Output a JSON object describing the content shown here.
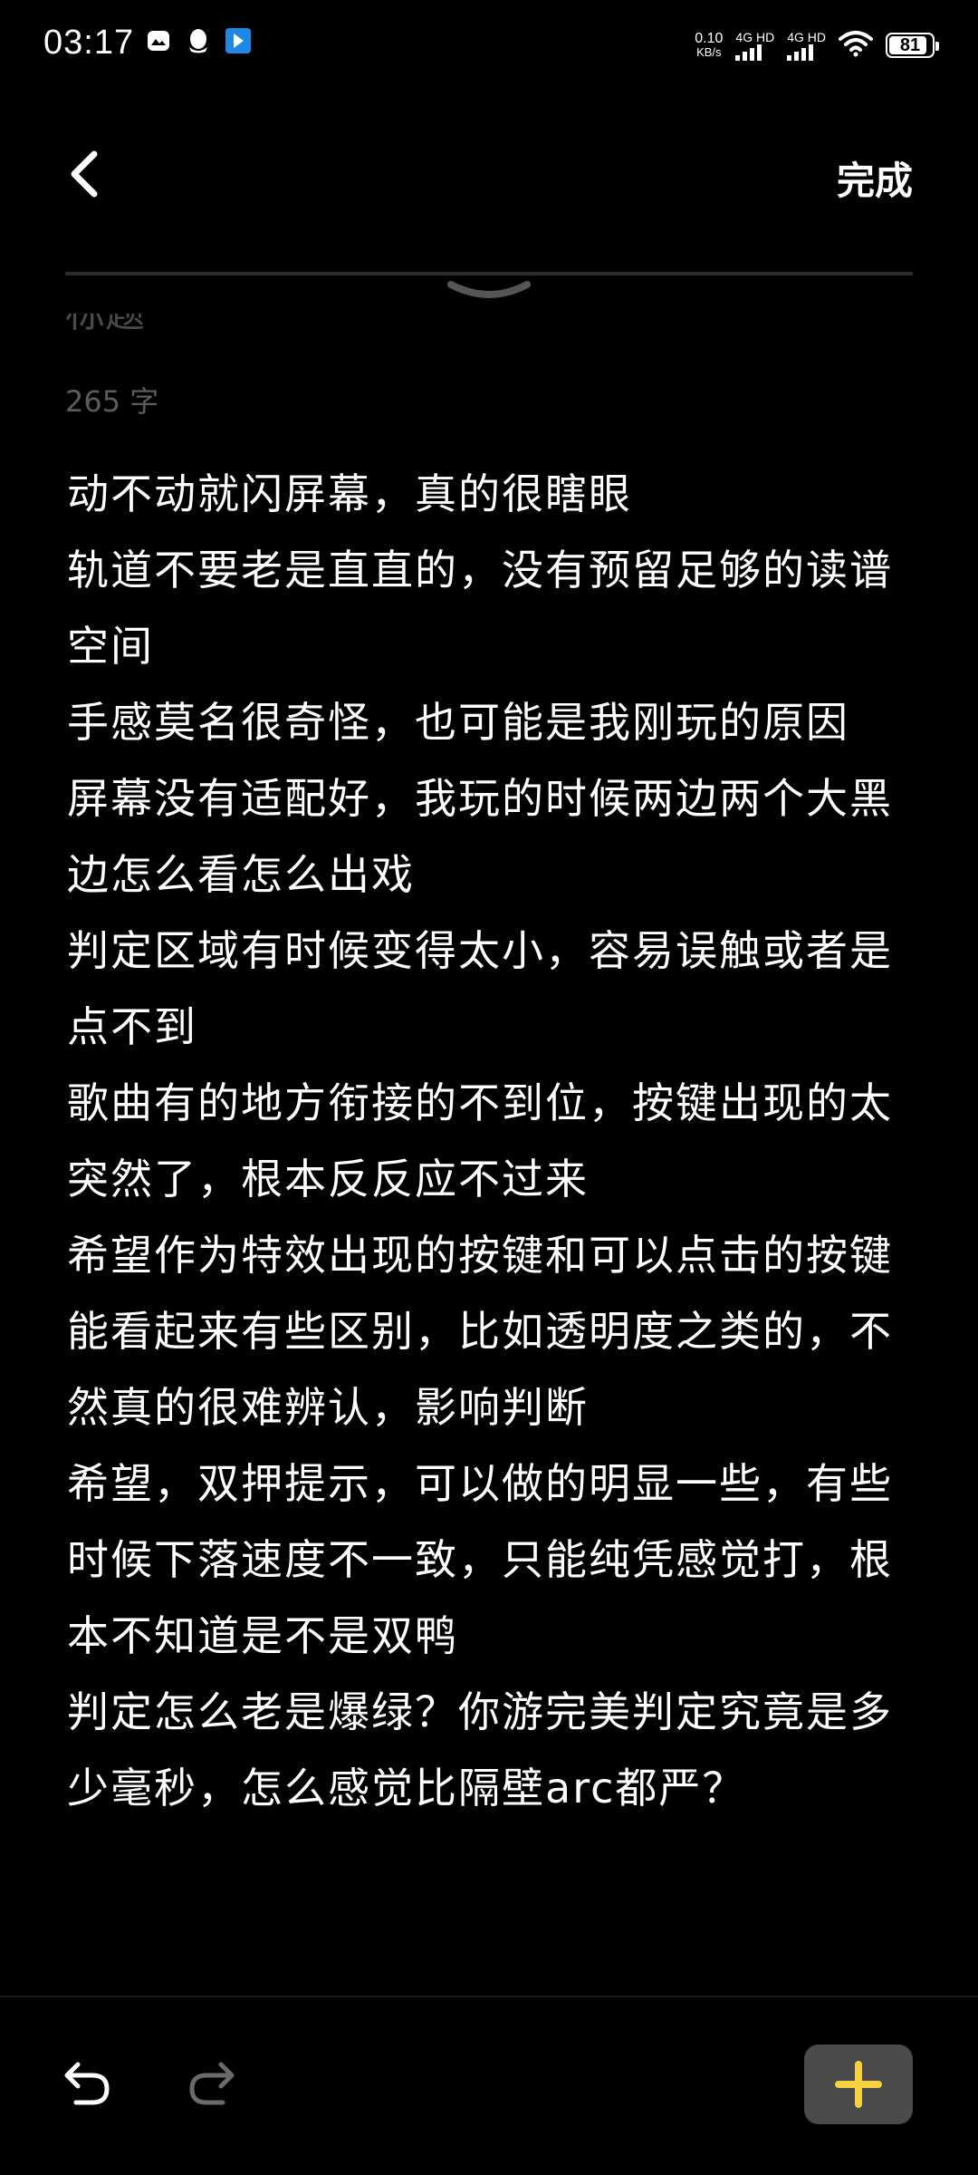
{
  "status_bar": {
    "time": "03:17",
    "net_speed_value": "0.10",
    "net_speed_unit": "KB/s",
    "sim1_label": "4G HD",
    "sim2_label": "4G HD",
    "battery_level": "81",
    "notification_icons": [
      "image-icon",
      "qq-icon",
      "app-icon"
    ]
  },
  "header": {
    "back_icon": "chevron-left-icon",
    "done_label": "完成",
    "collapse_icon": "chevron-down-icon"
  },
  "note": {
    "title_fragment": "标题",
    "char_count": "265 字",
    "lines": [
      "动不动就闪屏幕，真的很瞎眼",
      "轨道不要老是直直的，没有预留足够的读谱空间",
      "手感莫名很奇怪，也可能是我刚玩的原因",
      "屏幕没有适配好，我玩的时候两边两个大黑边怎么看怎么出戏",
      "判定区域有时候变得太小，容易误触或者是点不到",
      "歌曲有的地方衔接的不到位，按键出现的太突然了，根本反反应不过来",
      "希望作为特效出现的按键和可以点击的按键能看起来有些区别，比如透明度之类的，不然真的很难辨认，影响判断",
      "希望，双押提示，可以做的明显一些，有些时候下落速度不一致，只能纯凭感觉打，根本不知道是不是双鸭",
      "判定怎么老是爆绿？你游完美判定究竟是多少毫秒，怎么感觉比隔壁arc都严？"
    ]
  },
  "toolbar": {
    "undo_icon": "undo-icon",
    "redo_icon": "redo-icon",
    "add_icon": "plus-icon",
    "add_color": "#f5d142"
  }
}
